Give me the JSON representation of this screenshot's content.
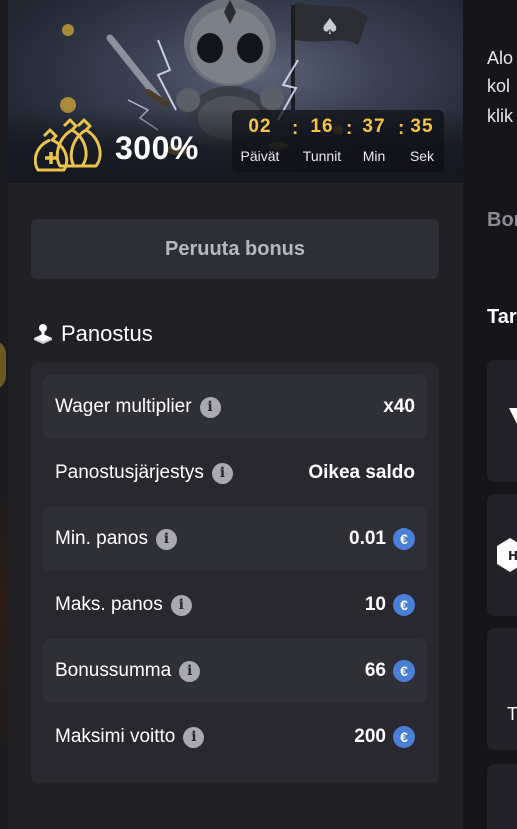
{
  "bonus": {
    "percentage": "300%",
    "countdown": [
      {
        "value": "02",
        "label": "Päivät"
      },
      {
        "value": "16",
        "label": "Tunnit"
      },
      {
        "value": "37",
        "label": "Min"
      },
      {
        "value": "35",
        "label": "Sek"
      }
    ],
    "separator": ":",
    "cancel_button": "Peruuta bonus"
  },
  "wagering": {
    "title": "Panostus",
    "rows": [
      {
        "label": "Wager multiplier",
        "value": "x40",
        "currency": false
      },
      {
        "label": "Panostusjärjestys",
        "value": "Oikea saldo",
        "currency": false
      },
      {
        "label": "Min. panos",
        "value": "0.01",
        "currency": true
      },
      {
        "label": "Maks. panos",
        "value": "10",
        "currency": true
      },
      {
        "label": "Bonussumma",
        "value": "66",
        "currency": true
      },
      {
        "label": "Maksimi voitto",
        "value": "200",
        "currency": true
      }
    ],
    "info_glyph": "i",
    "currency_glyph": "€"
  },
  "right_column": {
    "text_lines": [
      "Alo",
      "kol",
      "klik"
    ],
    "heading_1": "Bon",
    "heading_2": "Tar",
    "card_fragment": "T"
  },
  "colors": {
    "accent_gold": "#f5c443",
    "currency_blue": "#4a7fd8",
    "panel_bg": "#202025",
    "button_bg": "#2e2e36"
  }
}
